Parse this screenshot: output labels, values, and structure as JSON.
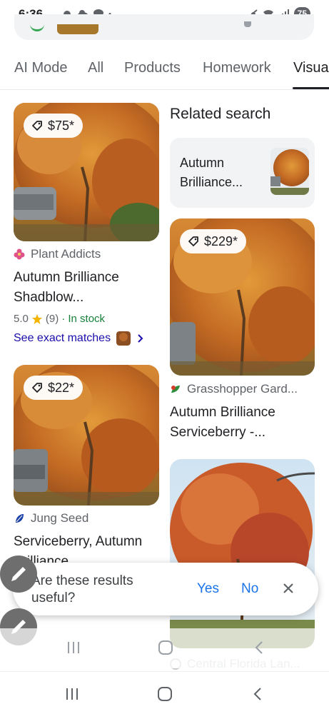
{
  "status_bar": {
    "time": "6:36",
    "battery": "75"
  },
  "tabs": [
    {
      "label": "AI Mode"
    },
    {
      "label": "All"
    },
    {
      "label": "Products"
    },
    {
      "label": "Homework"
    },
    {
      "label": "Visual"
    }
  ],
  "products": [
    {
      "price": "$75*",
      "source": "Plant Addicts",
      "title_line1": "Autumn Brilliance",
      "title_line2": "Shadblow...",
      "rating": "5.0",
      "reviews": "(9)",
      "stock": "· In stock",
      "exact_matches": "See exact matches"
    },
    {
      "price": "$22*",
      "source": "Jung Seed",
      "title_line1": "Serviceberry, Autumn",
      "title_line2": "Brilliance"
    },
    {
      "price": "$229*",
      "source": "Grasshopper Gard...",
      "title_line1": "Autumn Brilliance",
      "title_line2": "Serviceberry -..."
    },
    {
      "source": "Central Florida Lan..."
    }
  ],
  "related": {
    "title": "Related search",
    "label_line1": "Autumn",
    "label_line2": "Brilliance..."
  },
  "feedback": {
    "question_line1": "Are these results",
    "question_line2": "useful?",
    "yes": "Yes",
    "no": "No"
  },
  "colors": {
    "link_blue": "#1a73e8",
    "stock_green": "#188038",
    "foliage_orange": "#c8782a",
    "star_gold": "#f4b400"
  },
  "icons": [
    "tag-icon",
    "star-icon",
    "chevron-right-icon",
    "close-icon",
    "pencil-icon",
    "recents-icon",
    "home-icon",
    "back-icon"
  ]
}
